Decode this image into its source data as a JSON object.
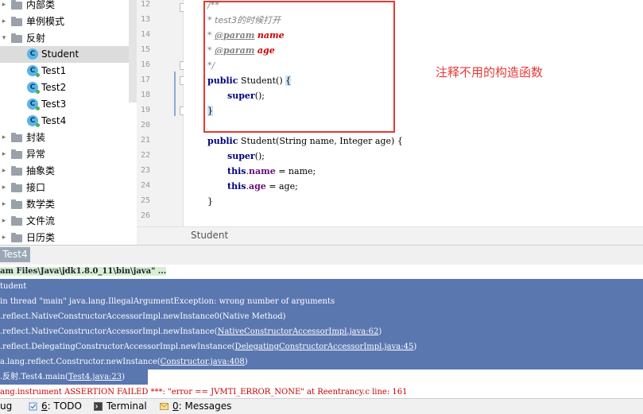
{
  "tree": {
    "items": [
      {
        "label": "内部类",
        "kind": "folder"
      },
      {
        "label": "单例模式",
        "kind": "folder"
      },
      {
        "label": "反射",
        "kind": "folder",
        "expanded": true
      },
      {
        "label": "Student",
        "kind": "class",
        "selected": true
      },
      {
        "label": "Test1",
        "kind": "runnable"
      },
      {
        "label": "Test2",
        "kind": "runnable"
      },
      {
        "label": "Test3",
        "kind": "runnable"
      },
      {
        "label": "Test4",
        "kind": "runnable"
      },
      {
        "label": "封装",
        "kind": "folder"
      },
      {
        "label": "异常",
        "kind": "folder"
      },
      {
        "label": "抽象类",
        "kind": "folder"
      },
      {
        "label": "接口",
        "kind": "folder"
      },
      {
        "label": "数学类",
        "kind": "folder"
      },
      {
        "label": "文件流",
        "kind": "folder"
      },
      {
        "label": "日历类",
        "kind": "folder"
      }
    ]
  },
  "editor": {
    "line_numbers": [
      "12",
      "13",
      "14",
      "15",
      "16",
      "17",
      "18",
      "19",
      "20",
      "21",
      "22",
      "23",
      "24",
      "25",
      "26"
    ],
    "code": {
      "l12": "/**",
      "l13_star": "* ",
      "l13_text": "test3的时候打开",
      "l14_star": "* ",
      "l14_tag": "@param",
      "l14_name": "name",
      "l15_star": "* ",
      "l15_tag": "@param",
      "l15_name": "age",
      "l16": "*/",
      "l17_kw": "public",
      "l17_rest": " Student() ",
      "l17_brace": "{",
      "l18_kw": "super",
      "l18_rest": "();",
      "l19_brace": "}",
      "l21_kw": "public",
      "l21_rest": " Student(String name, Integer age) {",
      "l22_kw": "super",
      "l22_rest": "();",
      "l23_this": "this",
      "l23_dot": ".",
      "l23_field": "name",
      "l23_rest": " = name;",
      "l24_this": "this",
      "l24_dot": ".",
      "l24_field": "age",
      "l24_rest": " = age;",
      "l25": "}"
    },
    "annotation": "注释不用的构造函数",
    "breadcrumb": "Student"
  },
  "run": {
    "tab_label": "Test4",
    "console": {
      "cmd": "am Files\\Java\\jdk1.8.0_11\\bin\\java\" ...",
      "c1": "tudent",
      "c2": "in thread \"main\" java.lang.IllegalArgumentException: wrong number of arguments",
      "c3": ".reflect.NativeConstructorAccessorImpl.newInstance0(Native Method)",
      "c4_pre": ".reflect.NativeConstructorAccessorImpl.newInstance(",
      "c4_link": "NativeConstructorAccessorImpl.java:62",
      "c4_post": ")",
      "c5_pre": ".reflect.DelegatingConstructorAccessorImpl.newInstance(",
      "c5_link": "DelegatingConstructorAccessorImpl.java:45",
      "c5_post": ")",
      "c6_pre": "a.lang.reflect.Constructor.newInstance(",
      "c6_link": "Constructor.java:408",
      "c6_post": ")",
      "c7_pre": ".反射.Test4.main(",
      "c7_link": "Test4.java:23",
      "c7_post": ")",
      "c8": "ang.instrument ASSERTION FAILED ***: \"error == JVMTI_ERROR_NONE\" at Reentrancy.c line: 161"
    }
  },
  "statusbar": {
    "debug_label": "ug",
    "todo_num": "6",
    "todo_label": ": TODO",
    "terminal_label": "Terminal",
    "messages_num": "0",
    "messages_label": ": Messages"
  },
  "colors": {
    "selection": "#5a77b0",
    "annotation_red": "#e53935",
    "keyword": "#000080",
    "field": "#660e7a"
  }
}
